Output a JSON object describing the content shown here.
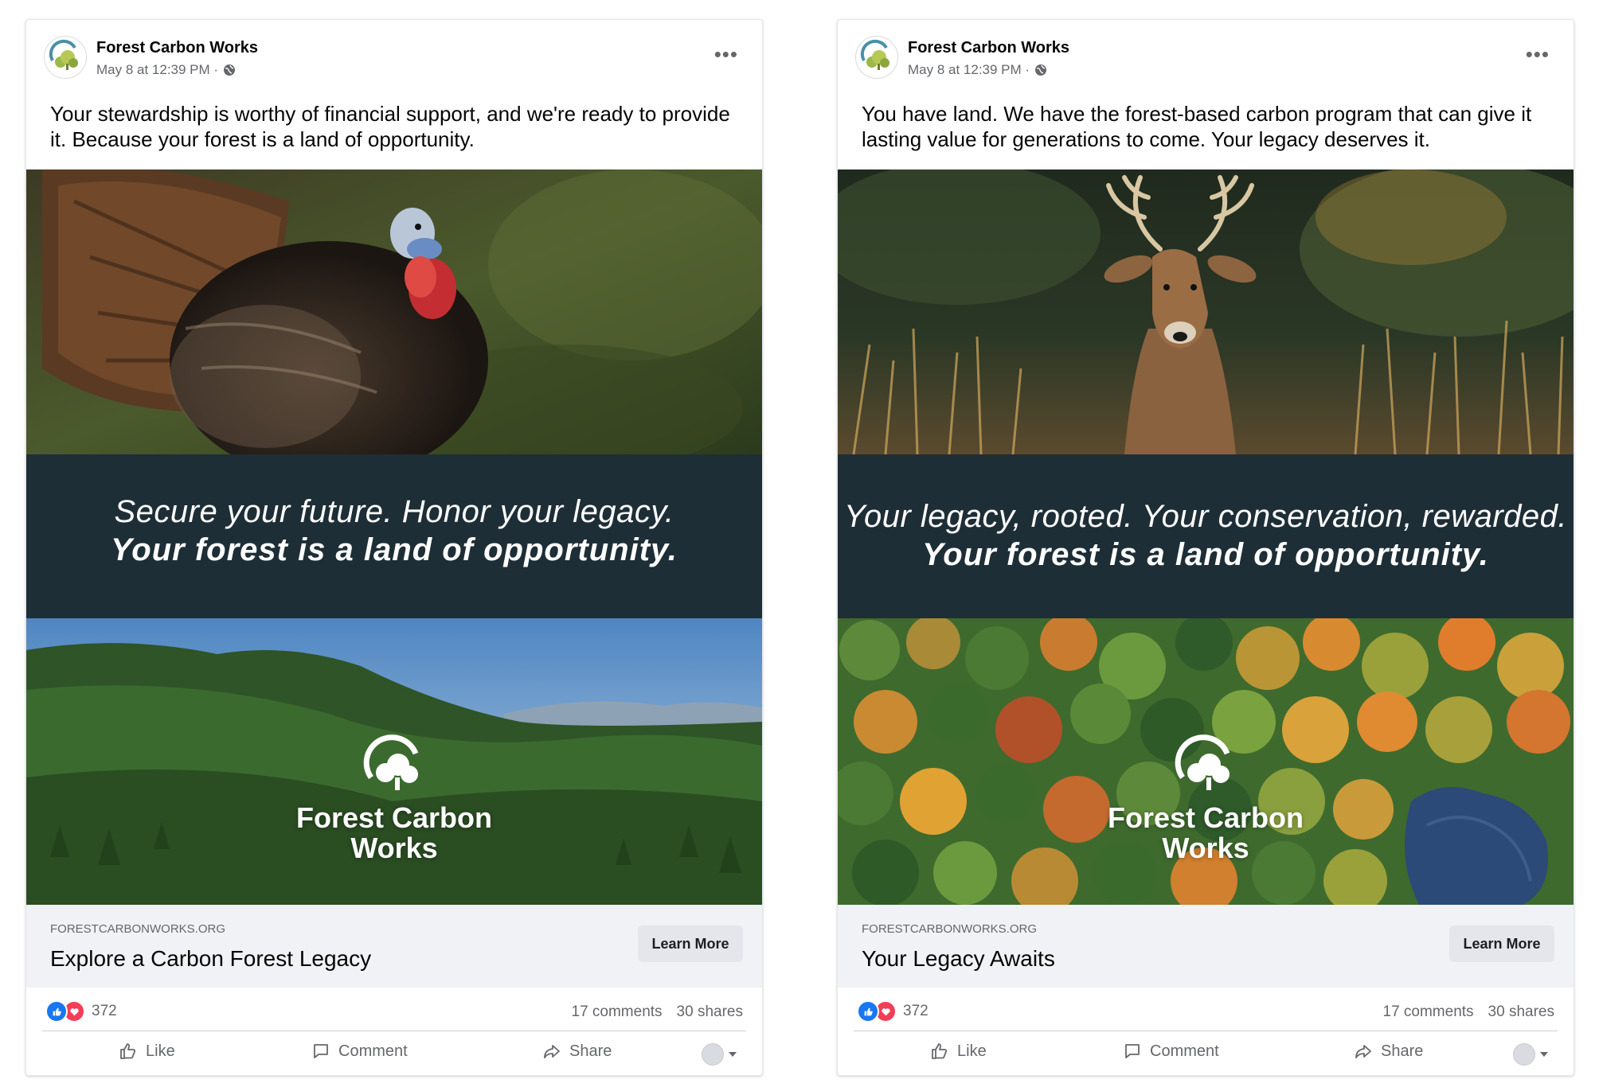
{
  "posts": [
    {
      "page_name": "Forest Carbon Works",
      "timestamp": "May 8 at 12:39 PM ·",
      "caption": "Your stewardship is worthy of financial support, and we're ready to provide it. Because your forest is a land of opportunity.",
      "creative": {
        "line1": "Secure your future. Honor your legacy.",
        "line2": "Your forest is a land of opportunity.",
        "brand_line1": "Forest Carbon",
        "brand_line2": "Works",
        "top_photo": "wild turkey",
        "bottom_photo": "forested valley"
      },
      "link": {
        "domain": "FORESTCARBONWORKS.ORG",
        "headline": "Explore a Carbon Forest Legacy",
        "cta": "Learn More"
      },
      "stats": {
        "reactions": "372",
        "comments": "17 comments",
        "shares": "30 shares"
      },
      "actions": {
        "like": "Like",
        "comment": "Comment",
        "share": "Share"
      }
    },
    {
      "page_name": "Forest Carbon Works",
      "timestamp": "May 8 at 12:39 PM ·",
      "caption": "You have land. We have the forest-based carbon program that can give it lasting value for generations to come. Your legacy deserves it.",
      "creative": {
        "line1": "Your legacy, rooted. Your conservation, rewarded.",
        "line2": "Your forest is a land of opportunity.",
        "brand_line1": "Forest Carbon",
        "brand_line2": "Works",
        "top_photo": "white-tailed deer",
        "bottom_photo": "aerial autumn forest"
      },
      "link": {
        "domain": "FORESTCARBONWORKS.ORG",
        "headline": "Your Legacy Awaits",
        "cta": "Learn More"
      },
      "stats": {
        "reactions": "372",
        "comments": "17 comments",
        "shares": "30 shares"
      },
      "actions": {
        "like": "Like",
        "comment": "Comment",
        "share": "Share"
      }
    }
  ],
  "colors": {
    "band": "#1e2e36",
    "like_blue": "#1877f2",
    "love_red": "#f33e58",
    "link_bar": "#f0f2f5"
  }
}
